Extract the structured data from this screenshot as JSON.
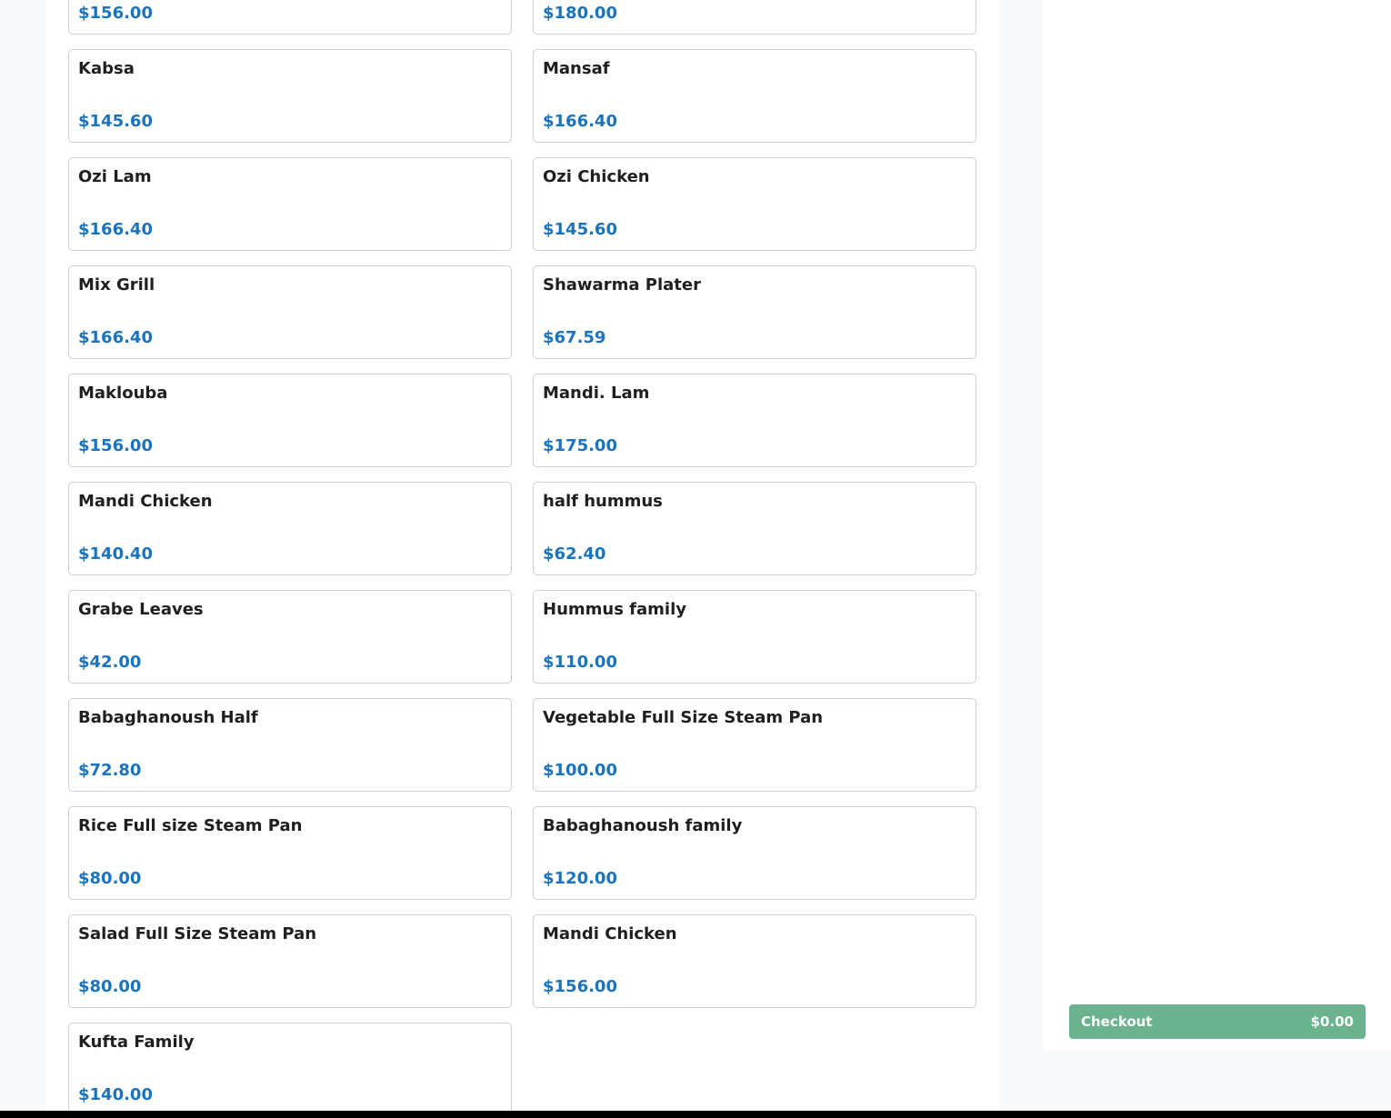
{
  "menu": {
    "items": [
      {
        "name": "",
        "price": "$156.00"
      },
      {
        "name": "",
        "price": "$180.00"
      },
      {
        "name": "Kabsa",
        "price": "$145.60"
      },
      {
        "name": "Mansaf",
        "price": "$166.40"
      },
      {
        "name": "Ozi Lam",
        "price": "$166.40"
      },
      {
        "name": "Ozi Chicken",
        "price": "$145.60"
      },
      {
        "name": "Mix Grill",
        "price": "$166.40"
      },
      {
        "name": "Shawarma Plater",
        "price": "$67.59"
      },
      {
        "name": "Maklouba",
        "price": "$156.00"
      },
      {
        "name": "Mandi. Lam",
        "price": "$175.00"
      },
      {
        "name": "Mandi Chicken",
        "price": "$140.40"
      },
      {
        "name": "half hummus",
        "price": "$62.40"
      },
      {
        "name": "Grabe Leaves",
        "price": "$42.00"
      },
      {
        "name": "Hummus family",
        "price": "$110.00"
      },
      {
        "name": "Babaghanoush Half",
        "price": "$72.80"
      },
      {
        "name": "Vegetable Full Size Steam Pan",
        "price": "$100.00"
      },
      {
        "name": "Rice Full size Steam Pan",
        "price": "$80.00"
      },
      {
        "name": "Babaghanoush family",
        "price": "$120.00"
      },
      {
        "name": "Salad Full Size Steam Pan",
        "price": "$80.00"
      },
      {
        "name": "Mandi Chicken",
        "price": "$156.00"
      },
      {
        "name": "Kufta Family",
        "price": "$140.00"
      }
    ]
  },
  "cart": {
    "checkout_label": "Checkout",
    "total": "$0.00"
  },
  "colors": {
    "price": "#1a73be",
    "checkout": "#6bb38e"
  }
}
